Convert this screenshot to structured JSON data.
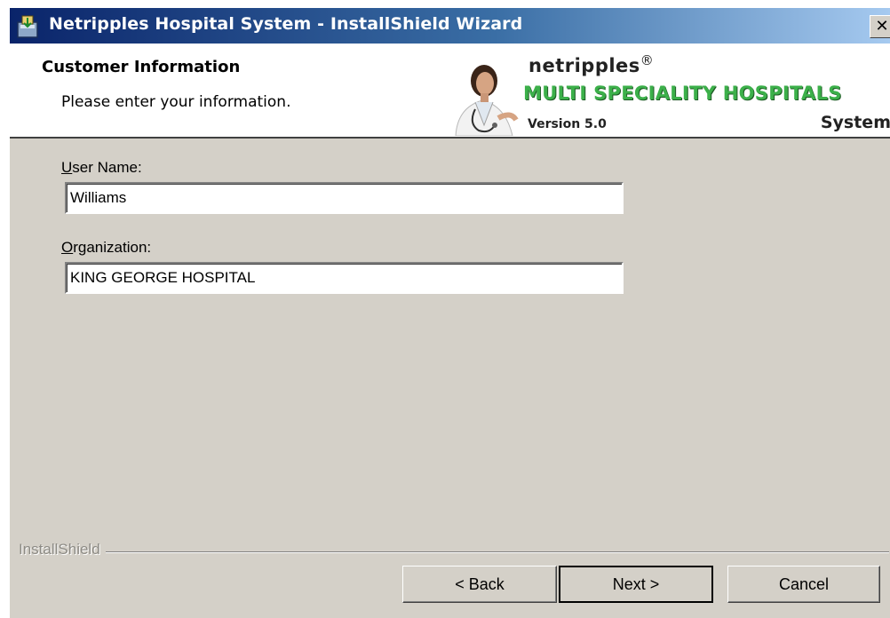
{
  "window": {
    "title": "Netripples Hospital System - InstallShield Wizard",
    "close_glyph": "✕",
    "icons": {
      "app": "installer-icon",
      "close": "close-icon"
    }
  },
  "banner": {
    "title": "Customer Information",
    "subtitle": "Please enter your information.",
    "brand": "netripples",
    "brand_mark": "®",
    "product": "MULTI SPECIALITY HOSPITALS",
    "version": "Version 5.0",
    "system": "System",
    "colors": {
      "product_green": "#3cb04a"
    }
  },
  "form": {
    "user_name": {
      "label_access": "U",
      "label_rest": "ser Name:",
      "value": "Williams"
    },
    "organization": {
      "label_access": "O",
      "label_rest": "rganization:",
      "value": "KING GEORGE HOSPITAL"
    }
  },
  "footer": {
    "brand_label": "InstallShield",
    "back_label": "< Back",
    "next_label": "Next >",
    "cancel_label": "Cancel"
  }
}
